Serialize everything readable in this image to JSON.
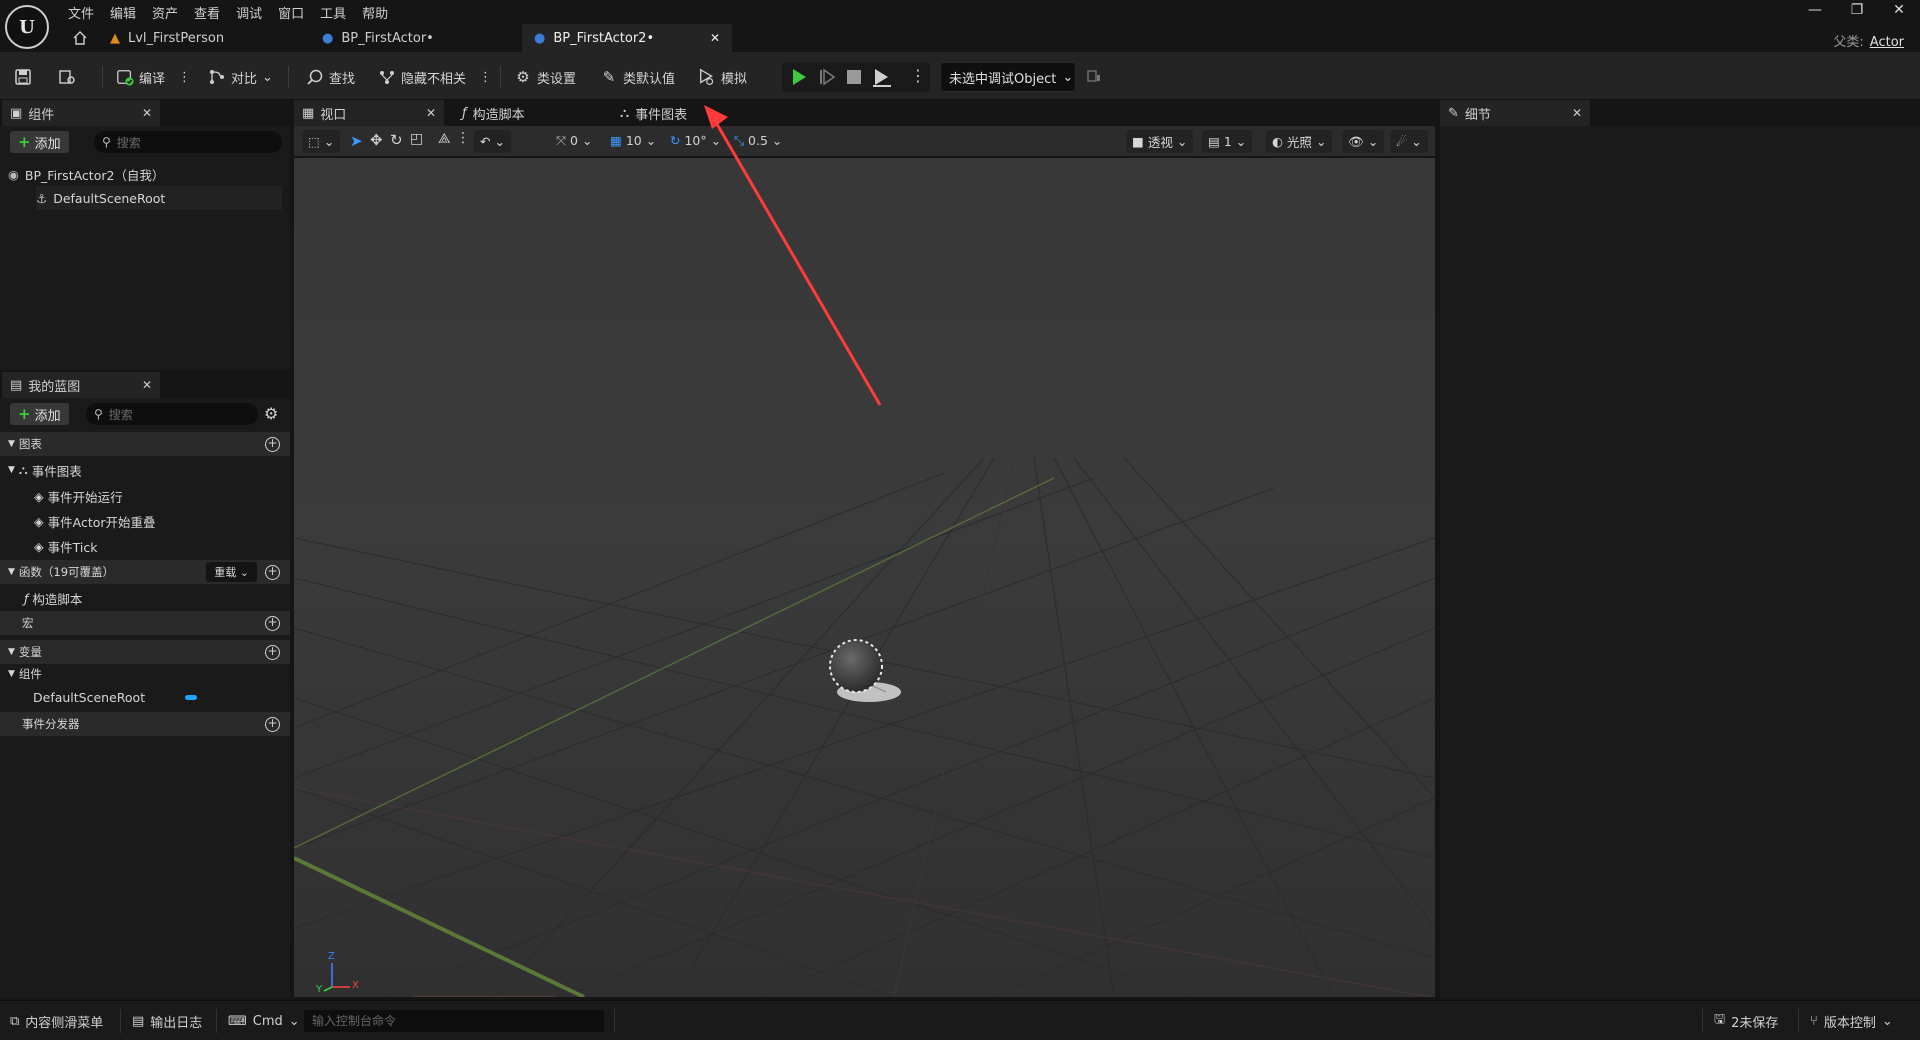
{
  "menu": [
    "文件",
    "编辑",
    "资产",
    "查看",
    "调试",
    "窗口",
    "工具",
    "帮助"
  ],
  "doc_tabs": [
    {
      "label": "Lvl_FirstPerson"
    },
    {
      "label": "BP_FirstActor•"
    },
    {
      "label": "BP_FirstActor2•"
    }
  ],
  "parent": {
    "label": "父类:",
    "value": "Actor"
  },
  "toolbar": {
    "compile": "编译",
    "diff": "对比",
    "find": "查找",
    "hide_unrelated": "隐藏不相关",
    "class_settings": "类设置",
    "class_defaults": "类默认值",
    "simulate": "模拟",
    "debug_object": "未选中调试Object"
  },
  "components_panel": {
    "tab": "组件",
    "add": "添加",
    "search_placeholder": "搜索",
    "root_item": "BP_FirstActor2（自我）",
    "child_item": "DefaultSceneRoot"
  },
  "blueprint_panel": {
    "tab": "我的蓝图",
    "add": "添加",
    "search_placeholder": "搜索",
    "graphs_section": "图表",
    "event_graph": "事件图表",
    "events": [
      "事件开始运行",
      "事件Actor开始重叠",
      "事件Tick"
    ],
    "functions_section": "函数（19可覆盖）",
    "override": "重载",
    "construction_script": "构造脚本",
    "macros_section": "宏",
    "variables_section": "变量",
    "components_group": "组件",
    "variable_item": "DefaultSceneRoot",
    "dispatchers_section": "事件分发器"
  },
  "center_tabs": {
    "viewport": "视口",
    "construction": "构造脚本",
    "event_graph": "事件图表"
  },
  "viewport_toolbar": {
    "rot_snap": "0",
    "grid_snap": "10",
    "angle_snap": "10°",
    "scale_snap": "0.5",
    "perspective": "透视",
    "camera_speed": "1",
    "lighting": "光照"
  },
  "axis": {
    "z": "Z",
    "y": "Y",
    "x": "X"
  },
  "details_panel": {
    "tab": "细节"
  },
  "statusbar": {
    "content_drawer": "内容侧滑菜单",
    "output_log": "输出日志",
    "cmd": "Cmd",
    "console_placeholder": "输入控制台命令",
    "unsaved": "2未保存",
    "source_control": "版本控制"
  },
  "colors": {
    "play_green": "#3ec93e",
    "accent_blue": "#2f8be0",
    "annotation_red": "#ff3b3b",
    "variable_pill": "#1fa6ff"
  }
}
